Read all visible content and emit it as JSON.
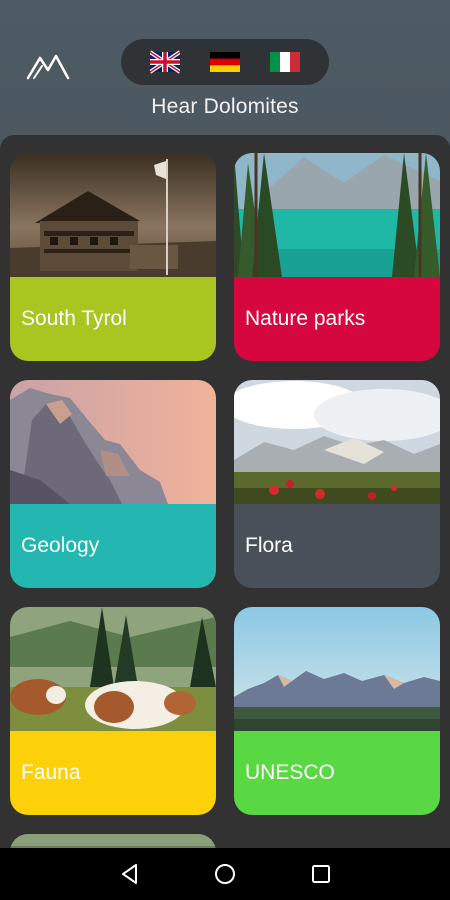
{
  "header": {
    "logo_icon": "mountain-logo-icon",
    "title": "Hear Dolomites",
    "languages": [
      {
        "code": "en",
        "icon": "uk-flag-icon"
      },
      {
        "code": "de",
        "icon": "germany-flag-icon"
      },
      {
        "code": "it",
        "icon": "italy-flag-icon"
      }
    ]
  },
  "categories": [
    {
      "label": "South Tyrol",
      "color": "#a8c520"
    },
    {
      "label": "Nature parks",
      "color": "#d6073e"
    },
    {
      "label": "Geology",
      "color": "#24b7b2"
    },
    {
      "label": "Flora",
      "color": "#4a505a"
    },
    {
      "label": "Fauna",
      "color": "#fdd10a"
    },
    {
      "label": "UNESCO",
      "color": "#5ad843"
    }
  ],
  "navbar": {
    "back_icon": "back-triangle-icon",
    "home_icon": "home-circle-icon",
    "recent_icon": "recent-square-icon"
  }
}
